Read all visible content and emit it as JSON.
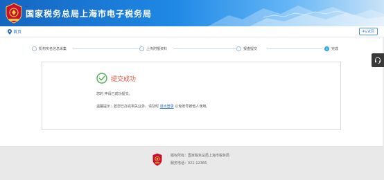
{
  "header": {
    "title": "国家税务总局上海市电子税务局"
  },
  "breadcrumb": {
    "home": "首页"
  },
  "back_button": {
    "label": "返回"
  },
  "steps": [
    {
      "num": "",
      "label": "机构实名信息采集",
      "state": "done"
    },
    {
      "num": "",
      "label": "上传附报资料",
      "state": "done"
    },
    {
      "num": "",
      "label": "报盘提交",
      "state": "done"
    },
    {
      "num": "4",
      "label": "完成",
      "state": "active"
    }
  ],
  "result": {
    "title": "提交成功",
    "message": "您的 申请已成功提交。",
    "tip_prefix": "温馨提示：若您已办完相关业务，请及时",
    "tip_link": "退出登录",
    "tip_suffix": "以免账号被他人误用。"
  },
  "footer": {
    "owner": "版权所有：国家税务总局上海市税务局",
    "phone": "服务电话：021-12366"
  },
  "colors": {
    "primary": "#1e88e5",
    "accent": "#29a3e8",
    "success": "#4caf50",
    "title_red": "#e8543a"
  },
  "icons": [
    "emblem-icon",
    "location-pin-icon",
    "back-arrow-icon",
    "check-circle-icon",
    "headset-icon",
    "footer-emblem-icon"
  ]
}
